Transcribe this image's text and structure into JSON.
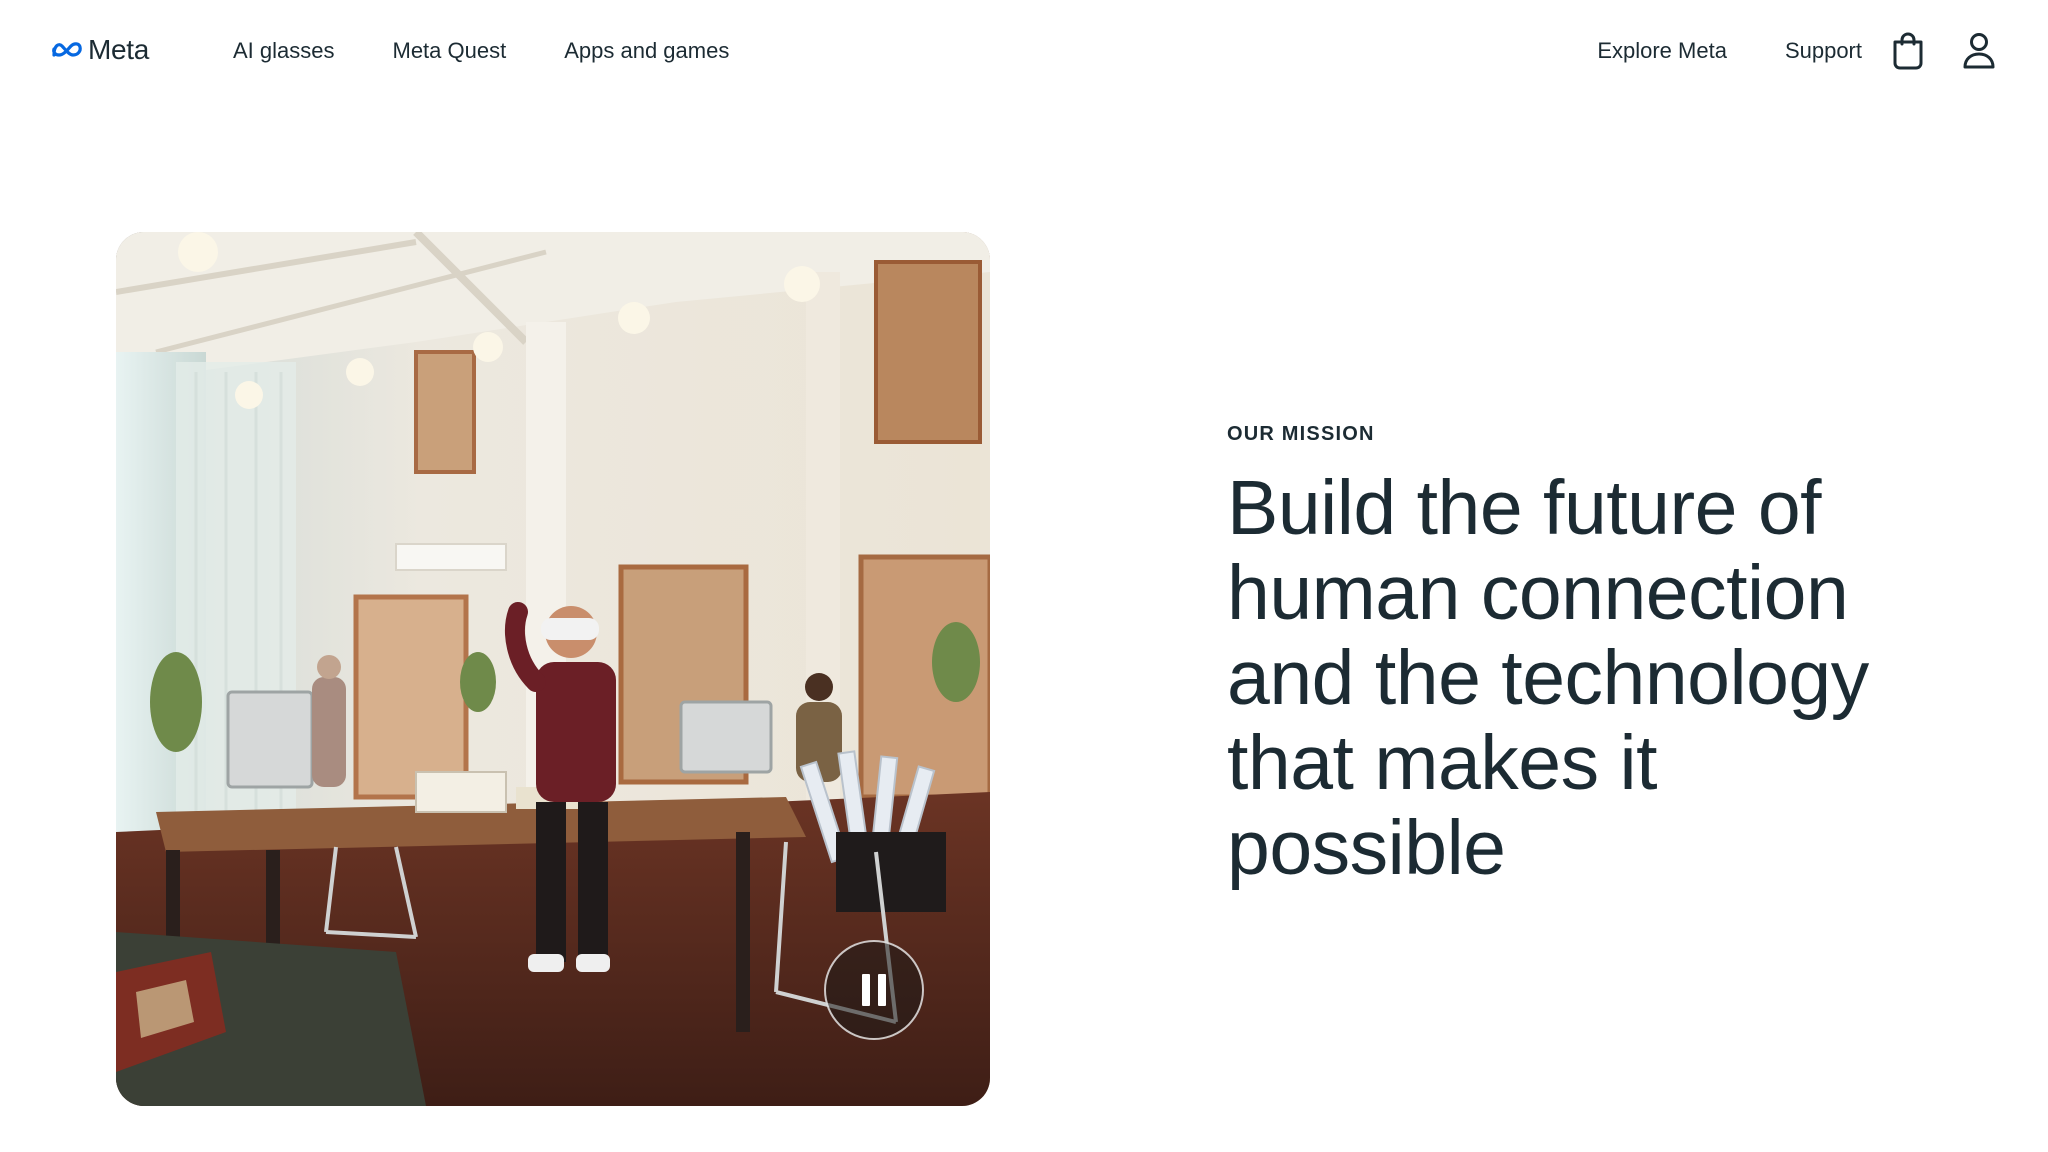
{
  "header": {
    "logo_text": "Meta",
    "nav_left": [
      "AI glasses",
      "Meta Quest",
      "Apps and games"
    ],
    "nav_right": [
      "Explore Meta",
      "Support"
    ],
    "icons": [
      "shopping-bag-icon",
      "account-icon"
    ]
  },
  "hero": {
    "media": {
      "icon": "pause-icon"
    },
    "eyebrow": "OUR MISSION",
    "headline": "Build the future of human connection and the technology that makes it possible"
  },
  "colors": {
    "text": "#1c2b33",
    "background": "#ffffff",
    "logo_blue": "#0668e1"
  }
}
